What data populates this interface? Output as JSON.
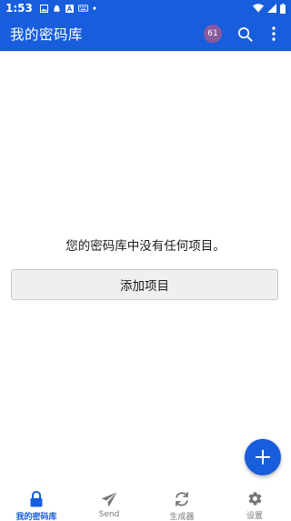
{
  "status_bar": {
    "time": "1:53",
    "notification_icons": [
      "image-icon",
      "snapchat-icon",
      "a-icon",
      "keyboard-icon",
      "dot-icon"
    ],
    "system_icons": [
      "wifi-icon",
      "signal-icon",
      "battery-icon"
    ]
  },
  "app_bar": {
    "title": "我的密码库",
    "avatar_text": "61",
    "avatar_color": "#8a5a9f",
    "actions": [
      "search-icon",
      "more-vert-icon"
    ]
  },
  "empty_state": {
    "message": "您的密码库中没有任何项目。",
    "add_button_label": "添加项目"
  },
  "fab": {
    "icon": "plus-icon"
  },
  "bottom_nav": {
    "items": [
      {
        "label": "我的密码库",
        "icon": "lock-icon",
        "active": true
      },
      {
        "label": "Send",
        "icon": "send-icon",
        "active": false
      },
      {
        "label": "生成器",
        "icon": "refresh-icon",
        "active": false
      },
      {
        "label": "设置",
        "icon": "gear-icon",
        "active": false
      }
    ]
  },
  "colors": {
    "primary": "#175ddc",
    "inactive": "#777777",
    "button_bg": "#efefef"
  }
}
